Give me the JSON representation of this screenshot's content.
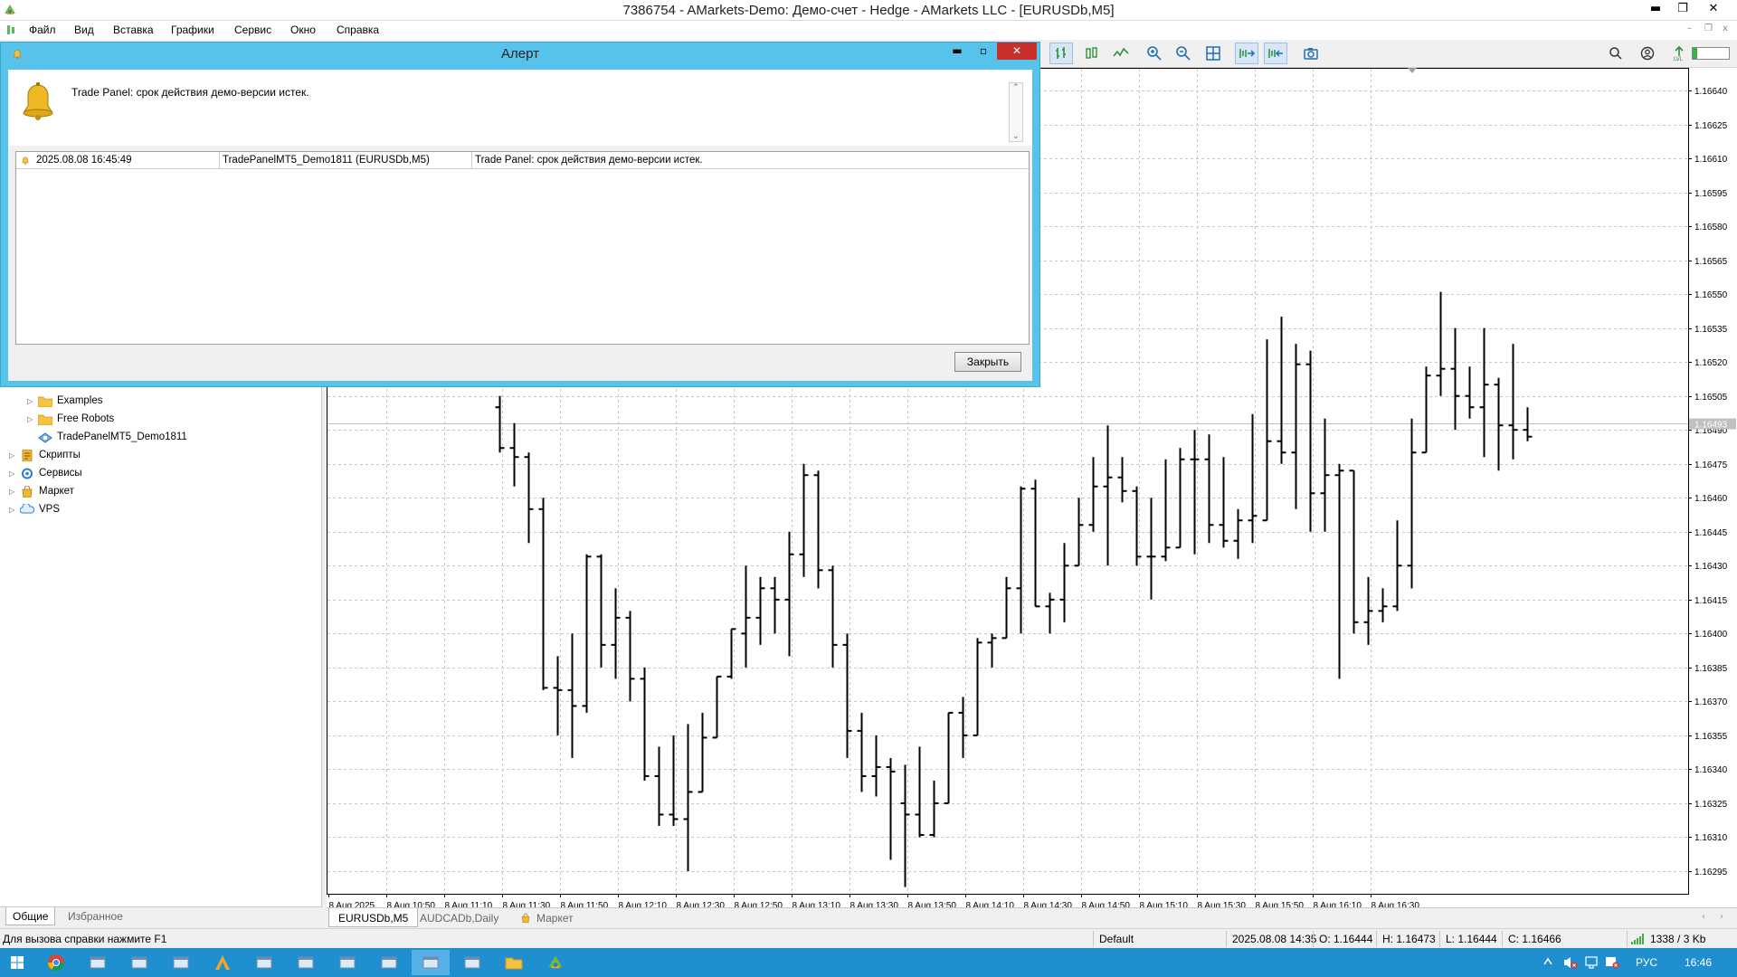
{
  "window": {
    "title": "7386754 - AMarkets-Demo: Демо-счет - Hedge - AMarkets LLC - [EURUSDb,M5]",
    "minimize": "▬",
    "restore": "❐",
    "close": "✕",
    "mdi_minimize": "–",
    "mdi_restore": "❐",
    "mdi_close": "x"
  },
  "menu": [
    "Файл",
    "Вид",
    "Вставка",
    "Графики",
    "Сервис",
    "Окно",
    "Справка"
  ],
  "toolbar": {
    "left_icons": [
      "bar-chart-icon",
      "candlestick-icon",
      "line-chart-icon",
      "zoom-in-icon",
      "zoom-out-icon",
      "grid-icon",
      "auto-scroll-icon",
      "chart-shift-icon",
      "screenshot-icon"
    ],
    "right_icons": [
      "search-icon",
      "account-icon",
      "signal-level-icon"
    ]
  },
  "alert": {
    "title": "Алерт",
    "message": "Trade Panel: срок действия демо-версии истек.",
    "row": {
      "time": "2025.08.08 16:45:49",
      "source": "TradePanelMT5_Demo1811 (EURUSDb,M5)",
      "text": "Trade Panel: срок действия демо-версии истек."
    },
    "close_button": "Закрыть",
    "minimize": "▬",
    "restore": "▫",
    "close": "✕"
  },
  "navigator": {
    "items": [
      {
        "label": "Examples",
        "icon": "folder-icon",
        "expandable": true
      },
      {
        "label": "Free Robots",
        "icon": "folder-icon",
        "expandable": true
      },
      {
        "label": "TradePanelMT5_Demo1811",
        "icon": "expert-advisor-icon",
        "expandable": false
      },
      {
        "label": "Скрипты",
        "icon": "scripts-icon",
        "expandable": true
      },
      {
        "label": "Сервисы",
        "icon": "services-icon",
        "expandable": true
      },
      {
        "label": "Маркет",
        "icon": "market-icon",
        "expandable": true
      },
      {
        "label": "VPS",
        "icon": "vps-cloud-icon",
        "expandable": true
      }
    ],
    "tabs": [
      "Общие",
      "Избранное"
    ]
  },
  "chart_data": {
    "type": "ohlc",
    "symbol": "EURUSDb",
    "timeframe": "M5",
    "ylim": [
      1.16285,
      1.1665
    ],
    "y_ticks": [
      "1.16640",
      "1.16625",
      "1.16610",
      "1.16595",
      "1.16580",
      "1.16565",
      "1.16550",
      "1.16535",
      "1.16520",
      "1.16505",
      "1.16490",
      "1.16475",
      "1.16460",
      "1.16445",
      "1.16430",
      "1.16415",
      "1.16400",
      "1.16385",
      "1.16370",
      "1.16355",
      "1.16340",
      "1.16325",
      "1.16310",
      "1.16295"
    ],
    "x_labels": [
      "8 Aug 2025",
      "8 Aug 10:50",
      "8 Aug 11:10",
      "8 Aug 11:30",
      "8 Aug 11:50",
      "8 Aug 12:10",
      "8 Aug 12:30",
      "8 Aug 12:50",
      "8 Aug 13:10",
      "8 Aug 13:30",
      "8 Aug 13:50",
      "8 Aug 14:10",
      "8 Aug 14:30",
      "8 Aug 14:50",
      "8 Aug 15:10",
      "8 Aug 15:30",
      "8 Aug 15:50",
      "8 Aug 16:10",
      "8 Aug 16:30"
    ],
    "current_price": "1.16493",
    "bid_line": 1.16493,
    "grid": true,
    "bars": [
      [
        1.165,
        1.16505,
        1.1648,
        1.16482
      ],
      [
        1.16482,
        1.16493,
        1.16465,
        1.16478
      ],
      [
        1.16478,
        1.1648,
        1.1644,
        1.16455
      ],
      [
        1.16455,
        1.1646,
        1.16375,
        1.16376
      ],
      [
        1.16376,
        1.1639,
        1.16355,
        1.16375
      ],
      [
        1.16375,
        1.164,
        1.16345,
        1.16368
      ],
      [
        1.16368,
        1.16435,
        1.16365,
        1.16434
      ],
      [
        1.16434,
        1.16435,
        1.16385,
        1.16395
      ],
      [
        1.16395,
        1.1642,
        1.1638,
        1.16407
      ],
      [
        1.16407,
        1.1641,
        1.1637,
        1.1638
      ],
      [
        1.1638,
        1.16385,
        1.16335,
        1.16337
      ],
      [
        1.16337,
        1.1635,
        1.16315,
        1.1632
      ],
      [
        1.1632,
        1.16355,
        1.16315,
        1.16318
      ],
      [
        1.16318,
        1.1636,
        1.16295,
        1.1633
      ],
      [
        1.1633,
        1.16365,
        1.16332,
        1.16354
      ],
      [
        1.16354,
        1.1637,
        1.16355,
        1.16381
      ],
      [
        1.16381,
        1.1639,
        1.1638,
        1.16402
      ],
      [
        1.164,
        1.1643,
        1.16385,
        1.16407
      ],
      [
        1.16407,
        1.16425,
        1.16395,
        1.1642
      ],
      [
        1.1642,
        1.16425,
        1.164,
        1.16415
      ],
      [
        1.16415,
        1.16445,
        1.1639,
        1.16435
      ],
      [
        1.16435,
        1.16475,
        1.16425,
        1.1647
      ],
      [
        1.1647,
        1.16472,
        1.1642,
        1.16428
      ],
      [
        1.16428,
        1.1643,
        1.16385,
        1.16395
      ],
      [
        1.16395,
        1.164,
        1.16345,
        1.16357
      ],
      [
        1.16357,
        1.16365,
        1.1633,
        1.16337
      ],
      [
        1.16337,
        1.16355,
        1.16328,
        1.16341
      ],
      [
        1.16341,
        1.16345,
        1.163,
        1.16339
      ],
      [
        1.16325,
        1.16342,
        1.16288,
        1.1632
      ],
      [
        1.1632,
        1.1635,
        1.1631,
        1.16311
      ],
      [
        1.16311,
        1.16335,
        1.1631,
        1.16325
      ],
      [
        1.16325,
        1.16365,
        1.1634,
        1.16365
      ],
      [
        1.16365,
        1.16372,
        1.16345,
        1.16355
      ],
      [
        1.16355,
        1.16398,
        1.16355,
        1.16396
      ],
      [
        1.16396,
        1.164,
        1.16385,
        1.16398
      ],
      [
        1.16398,
        1.16425,
        1.164,
        1.1642
      ],
      [
        1.1642,
        1.16465,
        1.164,
        1.16464
      ],
      [
        1.16464,
        1.16468,
        1.16412,
        1.16412
      ],
      [
        1.16412,
        1.16418,
        1.164,
        1.16415
      ],
      [
        1.16415,
        1.1644,
        1.16405,
        1.1643
      ],
      [
        1.1643,
        1.1646,
        1.16435,
        1.16448
      ],
      [
        1.16448,
        1.16478,
        1.16445,
        1.16465
      ],
      [
        1.16465,
        1.16492,
        1.1643,
        1.16469
      ],
      [
        1.16469,
        1.16478,
        1.16458,
        1.16463
      ],
      [
        1.16463,
        1.16465,
        1.1643,
        1.16434
      ],
      [
        1.16434,
        1.1646,
        1.16415,
        1.16434
      ],
      [
        1.16434,
        1.16477,
        1.16432,
        1.16438
      ],
      [
        1.16438,
        1.16482,
        1.16472,
        1.16477
      ],
      [
        1.16477,
        1.1649,
        1.16435,
        1.16477
      ],
      [
        1.16477,
        1.16488,
        1.1644,
        1.16448
      ],
      [
        1.16448,
        1.16478,
        1.16438,
        1.16441
      ],
      [
        1.16441,
        1.16455,
        1.16433,
        1.1645
      ],
      [
        1.1645,
        1.16497,
        1.1644,
        1.16452
      ],
      [
        1.1645,
        1.1653,
        1.16465,
        1.16485
      ],
      [
        1.16485,
        1.1654,
        1.16475,
        1.1648
      ],
      [
        1.1648,
        1.16528,
        1.16455,
        1.16519
      ],
      [
        1.16519,
        1.16525,
        1.16445,
        1.16462
      ],
      [
        1.16462,
        1.16495,
        1.16445,
        1.1647
      ],
      [
        1.1647,
        1.16475,
        1.1638,
        1.16472
      ],
      [
        1.16472,
        1.1643,
        1.164,
        1.16405
      ],
      [
        1.16405,
        1.16425,
        1.16395,
        1.1641
      ],
      [
        1.1641,
        1.1642,
        1.16405,
        1.16412
      ],
      [
        1.16412,
        1.1645,
        1.1641,
        1.1643
      ],
      [
        1.1643,
        1.16495,
        1.1642,
        1.1648
      ],
      [
        1.1648,
        1.16518,
        1.1648,
        1.16514
      ],
      [
        1.16514,
        1.16551,
        1.16505,
        1.16517
      ],
      [
        1.16517,
        1.16535,
        1.1649,
        1.16505
      ],
      [
        1.16505,
        1.16518,
        1.16495,
        1.165
      ],
      [
        1.165,
        1.16535,
        1.16478,
        1.1651
      ],
      [
        1.1651,
        1.16513,
        1.16472,
        1.16492
      ],
      [
        1.16492,
        1.16528,
        1.16477,
        1.1649
      ],
      [
        1.1649,
        1.165,
        1.16485,
        1.16487
      ]
    ]
  },
  "chart_tabs": [
    "EURUSDb,M5",
    "AUDCADb,Daily",
    "Маркет"
  ],
  "status": {
    "help": "Для вызова справки нажмите F1",
    "profile": "Default",
    "datetime": "2025.08.08 14:35",
    "open": "O: 1.16444",
    "high": "H: 1.16473",
    "low": "L: 1.16444",
    "close": "C: 1.16466",
    "traffic": "1338 / 3 Kb"
  },
  "taskbar": {
    "tray_lang": "РУС",
    "tray_time": "16:46"
  },
  "colors": {
    "dialog_frame": "#58c3ea",
    "taskbar": "#1f8fd0",
    "grid": "#c8c8c8",
    "bar": "#000000",
    "bid_line": "#c0c0c0"
  }
}
